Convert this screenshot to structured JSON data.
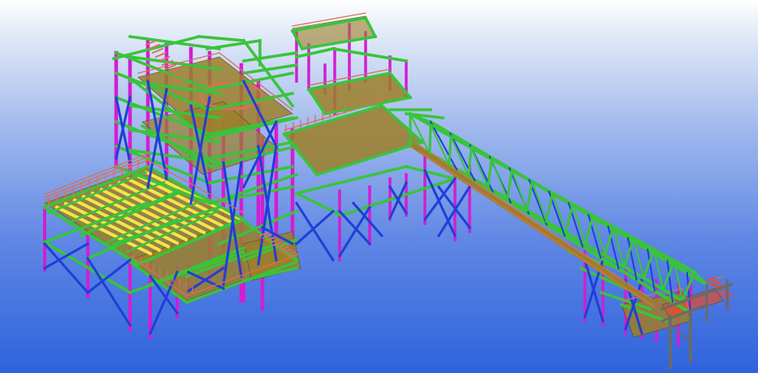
{
  "viewport": {
    "background_top": "#ffffff",
    "background_bottom": "#2f63dc"
  },
  "colors": {
    "column": "#d21ed2",
    "beam": "#39c43a",
    "brace": "#1f3fd8",
    "grating": "#9c7f28",
    "handrail": "#d9705a",
    "yellow_beam": "#f2e64a",
    "support": "#6a6a6a",
    "hilite": "#e84a2a"
  }
}
